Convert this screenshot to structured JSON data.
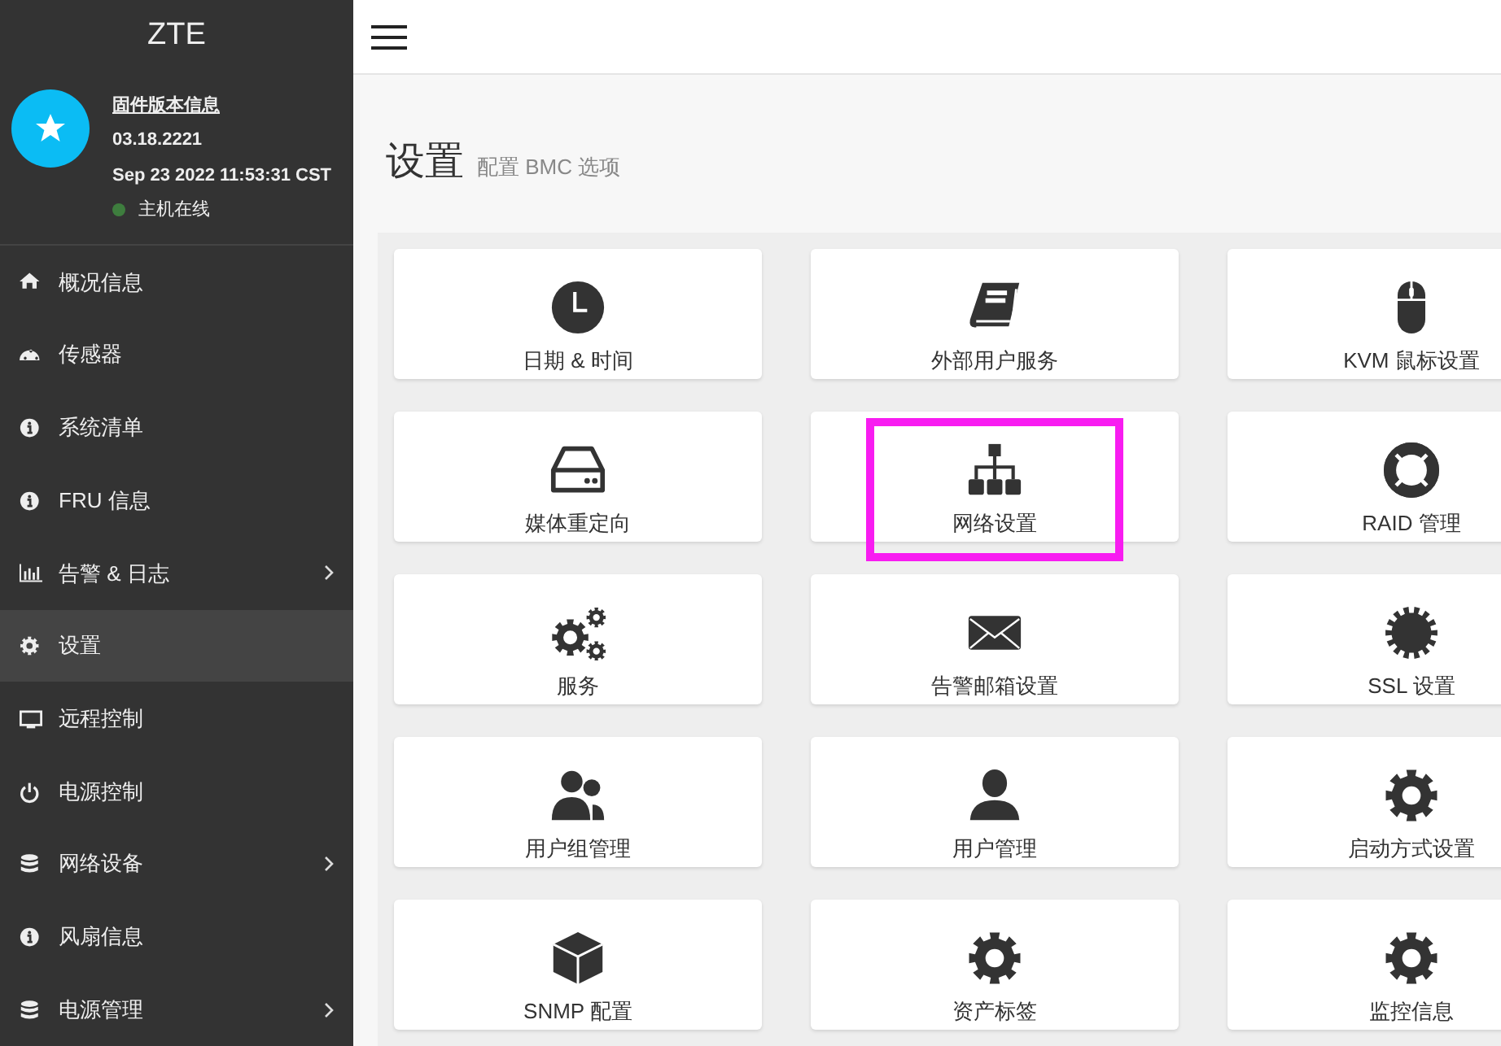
{
  "sidebar": {
    "brand": "ZTE",
    "profile": {
      "link": "固件版本信息",
      "version": "03.18.2221",
      "build_time": "Sep 23 2022 11:53:31 CST",
      "status": "主机在线",
      "online": true
    },
    "items": [
      {
        "label": "概况信息",
        "selected": false,
        "expandable": false
      },
      {
        "label": "传感器",
        "selected": false,
        "expandable": false
      },
      {
        "label": "系统清单",
        "selected": false,
        "expandable": false
      },
      {
        "label": "FRU 信息",
        "selected": false,
        "expandable": false
      },
      {
        "label": "告警 & 日志",
        "selected": false,
        "expandable": true
      },
      {
        "label": "设置",
        "selected": true,
        "expandable": false
      },
      {
        "label": "远程控制",
        "selected": false,
        "expandable": false
      },
      {
        "label": "电源控制",
        "selected": false,
        "expandable": false
      },
      {
        "label": "网络设备",
        "selected": false,
        "expandable": true
      },
      {
        "label": "风扇信息",
        "selected": false,
        "expandable": false
      },
      {
        "label": "电源管理",
        "selected": false,
        "expandable": true
      }
    ]
  },
  "page": {
    "title": "设置",
    "subtitle": "配置 BMC 选项"
  },
  "tiles": [
    {
      "label": "日期 & 时间",
      "highlighted": false
    },
    {
      "label": "外部用户服务",
      "highlighted": false
    },
    {
      "label": "KVM 鼠标设置",
      "highlighted": false
    },
    {
      "label": "媒体重定向",
      "highlighted": false
    },
    {
      "label": "网络设置",
      "highlighted": true
    },
    {
      "label": "RAID 管理",
      "highlighted": false
    },
    {
      "label": "服务",
      "highlighted": false
    },
    {
      "label": "告警邮箱设置",
      "highlighted": false
    },
    {
      "label": "SSL 设置",
      "highlighted": false
    },
    {
      "label": "用户组管理",
      "highlighted": false
    },
    {
      "label": "用户管理",
      "highlighted": false
    },
    {
      "label": "启动方式设置",
      "highlighted": false
    },
    {
      "label": "SNMP 配置",
      "highlighted": false
    },
    {
      "label": "资产标签",
      "highlighted": false
    },
    {
      "label": "监控信息",
      "highlighted": false
    }
  ]
}
